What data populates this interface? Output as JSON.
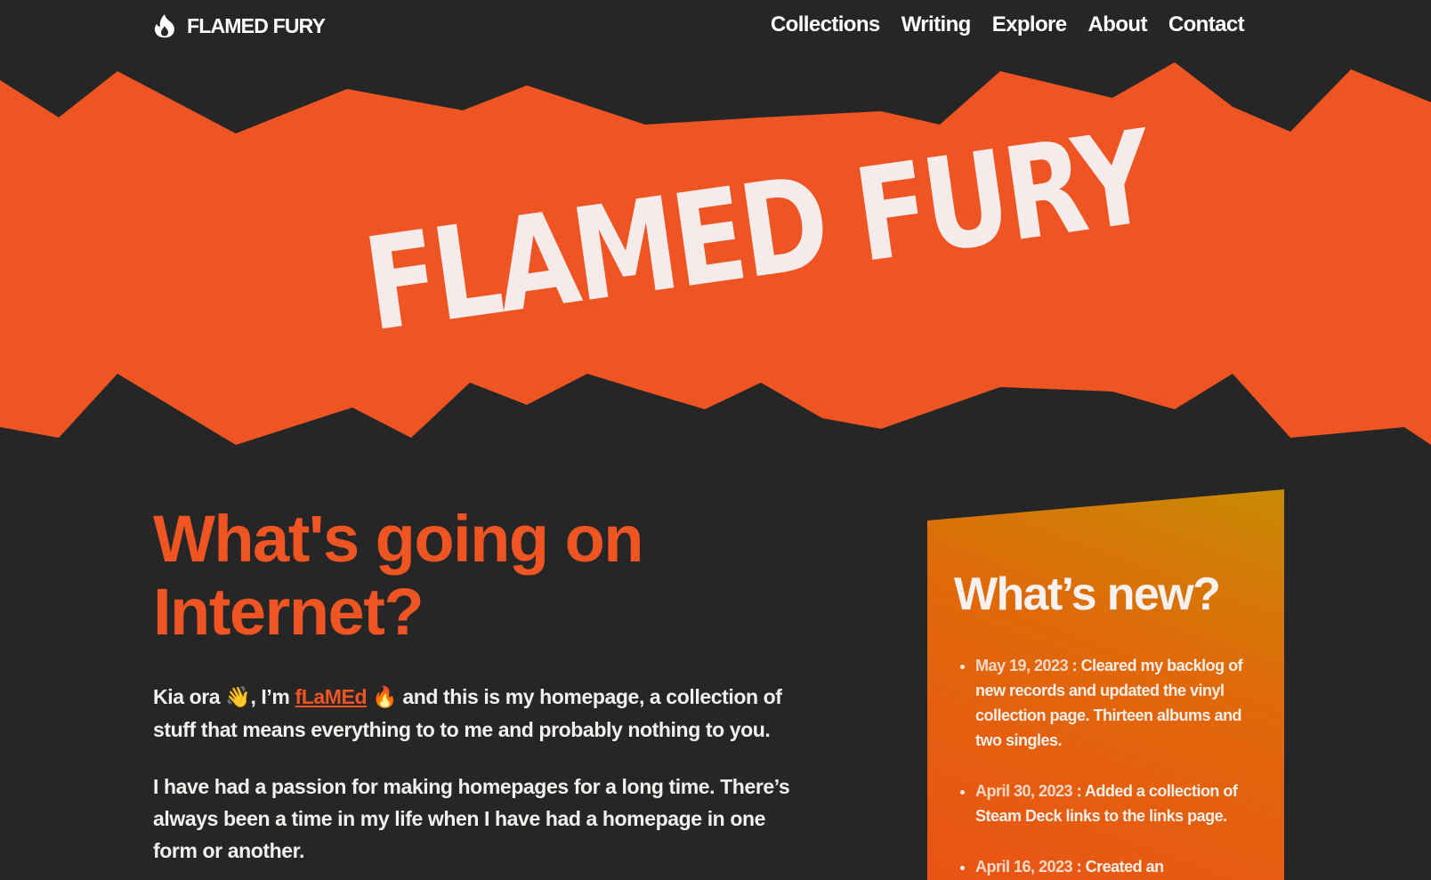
{
  "nav": {
    "brand": "FLAMED FURY",
    "brand_icon": "flame-icon",
    "links": [
      "Collections",
      "Writing",
      "Explore",
      "About",
      "Contact"
    ]
  },
  "hero": {
    "title": "FLAMED FURY",
    "band_color": "#ef5423"
  },
  "main": {
    "heading_line1": "What's going on",
    "heading_line2": "Internet?",
    "intro_prefix": "Kia ora",
    "wave_emoji": "👋",
    "intro_im": ", I’m",
    "name_link": "fLaMEd",
    "fire_emoji": "🔥",
    "intro_suffix": "and this is my homepage, a collection of stuff that means everything to to me and probably nothing to you.",
    "paragraph2": "I have had a passion for making homepages for a long time. There’s always been a time in my life when I have had a homepage in one form or another."
  },
  "news": {
    "title": "What’s new?",
    "items": [
      {
        "date": "May 19, 2023",
        "text": " : Cleared my backlog of new records and updated the vinyl collection page. Thirteen albums and two singles."
      },
      {
        "date": "April 30, 2023",
        "text": " : Added a collection of Steam Deck links to the links page."
      },
      {
        "date": "April 16, 2023",
        "text": " : Created an"
      }
    ]
  },
  "colors": {
    "background": "#262626",
    "accent": "#ef5423",
    "text": "#f3eeee"
  }
}
